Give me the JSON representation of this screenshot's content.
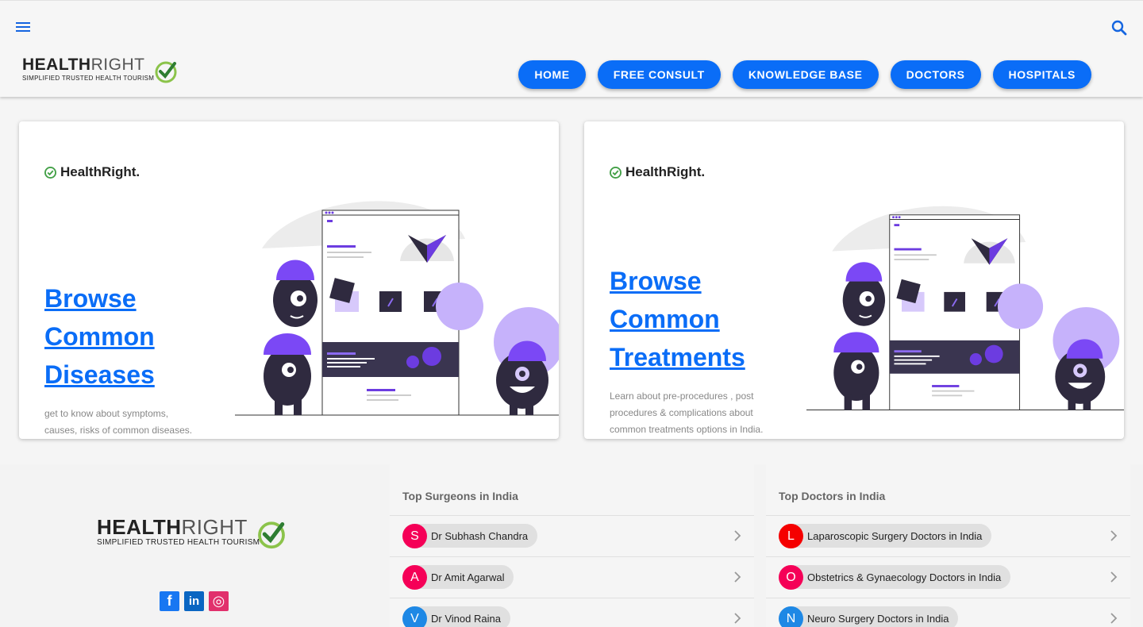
{
  "header": {
    "logo_brand_bold": "HEALTH",
    "logo_brand_light": "RIGHT",
    "logo_tagline": "SIMPLIFIED TRUSTED HEALTH TOURISM",
    "menu_icon": "menu-icon",
    "search_icon": "search-icon",
    "nav": [
      "HOME",
      "FREE CONSULT",
      "KNOWLEDGE BASE",
      "DOCTORS",
      "HOSPITALS"
    ],
    "accent_color": "#0a6df7"
  },
  "cards": [
    {
      "brand": "HealthRight.",
      "title": "Browse Common Diseases",
      "description": "get to know about symptoms, causes, risks of common diseases."
    },
    {
      "brand": "HealthRight.",
      "title": "Browse Common Treatments",
      "description": "Learn about pre-procedures , post procedures & complications about common treatments options in India."
    }
  ],
  "footer": {
    "logo_brand_bold": "HEALTH",
    "logo_brand_light": "RIGHT",
    "logo_tagline": "SIMPLIFIED TRUSTED HEALTH TOURISM",
    "social": [
      {
        "icon": "facebook-icon",
        "glyph": "f"
      },
      {
        "icon": "linkedin-icon",
        "glyph": "in"
      },
      {
        "icon": "instagram-icon",
        "glyph": "◎"
      }
    ],
    "surgeons": {
      "title": "Top Surgeons in India",
      "items": [
        {
          "initial": "S",
          "name": "Dr Subhash Chandra",
          "color": "#f50057"
        },
        {
          "initial": "A",
          "name": "Dr Amit Agarwal",
          "color": "#f50057"
        },
        {
          "initial": "V",
          "name": "Dr Vinod Raina",
          "color": "#1e88e5"
        }
      ]
    },
    "doctors": {
      "title": "Top Doctors in India",
      "items": [
        {
          "initial": "L",
          "name": "Laparoscopic Surgery Doctors in India",
          "color": "#f50000"
        },
        {
          "initial": "O",
          "name": "Obstetrics & Gynaecology Doctors in India",
          "color": "#f50057"
        },
        {
          "initial": "N",
          "name": "Neuro Surgery Doctors in India",
          "color": "#1e88e5"
        }
      ]
    }
  }
}
